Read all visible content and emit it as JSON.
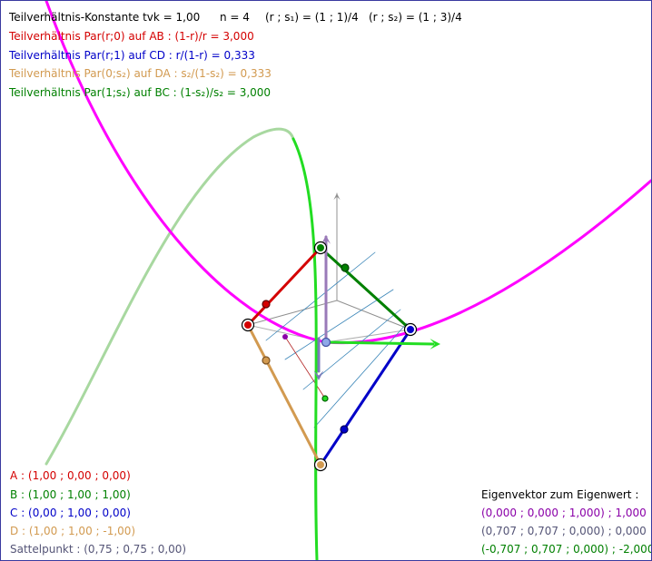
{
  "header": {
    "tvk": "Teilverhältnis-Konstante tvk = 1,00",
    "n": "n = 4",
    "rs1": "(r ; s₁) = (1 ; 1)/4",
    "rs2": "(r ; s₂) = (1 ; 3)/4"
  },
  "ratios": [
    {
      "text": "Teilverhältnis Par(r;0) auf AB : (1-r)/r = 3,000",
      "color": "#d40000"
    },
    {
      "text": "Teilverhältnis Par(r;1) auf CD : r/(1-r) = 0,333",
      "color": "#0000c8"
    },
    {
      "text": "Teilverhältnis Par(0;s₂) auf DA : s₂/(1-s₂) = 0,333",
      "color": "#d29a50"
    },
    {
      "text": "Teilverhältnis Par(1;s₂) auf BC : (1-s₂)/s₂ = 3,000",
      "color": "#008000"
    }
  ],
  "points": {
    "A": {
      "text": "A : (1,00 ; 0,00 ; 0,00)",
      "color": "#d40000"
    },
    "B": {
      "text": "B : (1,00 ; 1,00 ; 1,00)",
      "color": "#008000"
    },
    "C": {
      "text": "C : (0,00 ; 1,00 ; 0,00)",
      "color": "#0000c8"
    },
    "D": {
      "text": "D : (1,00 ; 1,00 ; -1,00)",
      "color": "#d29a50"
    },
    "S": {
      "text": "Sattelpunkt : (0,75 ; 0,75 ; 0,00)",
      "color": "#555577"
    }
  },
  "eigen": {
    "title": "Eigenvektor zum Eigenwert :",
    "rows": [
      {
        "text": "(0,000 ; 0,000 ; 1,000) ; 1,000",
        "color": "#8a00a8"
      },
      {
        "text": "(0,707 ; 0,707 ; 0,000) ; 0,000",
        "color": "#555577"
      },
      {
        "text": "(-0,707 ; 0,707 ; 0,000) ; -2,000",
        "color": "#008000"
      }
    ]
  },
  "colors": {
    "red": "#d40000",
    "green": "#008000",
    "blue": "#0000c8",
    "orange": "#d29a50",
    "magenta": "#ff00ff",
    "brightgreen": "#22dd22",
    "palegreen": "#a8d8a0",
    "purple": "#8a00a8",
    "frame": "#3a3aa0"
  }
}
